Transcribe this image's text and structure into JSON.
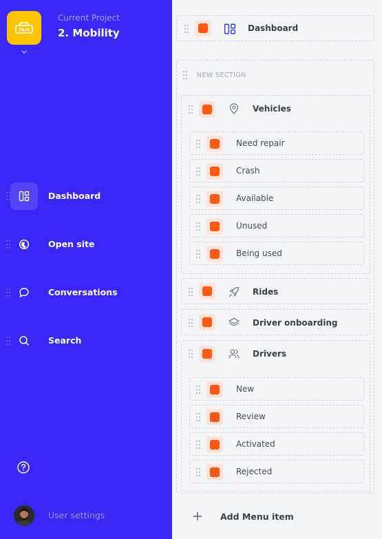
{
  "project": {
    "label": "Current Project",
    "name": "2. Mobility",
    "logo_text": "TAXI"
  },
  "sidebar": {
    "items": [
      {
        "label": "Dashboard",
        "icon": "dashboard-icon",
        "active": true
      },
      {
        "label": "Open site",
        "icon": "globe-icon",
        "active": false
      },
      {
        "label": "Conversations",
        "icon": "chat-icon",
        "active": false
      },
      {
        "label": "Search",
        "icon": "search-icon",
        "active": false
      }
    ],
    "user_settings": "User settings"
  },
  "menu": {
    "dashboard": {
      "label": "Dashboard",
      "icon": "dashboard-icon"
    },
    "section_title": "NEW SECTION",
    "vehicles": {
      "label": "Vehicles",
      "icon": "location-pin-icon",
      "children": [
        "Need repair",
        "Crash",
        "Available",
        "Unused",
        "Being used"
      ]
    },
    "rides": {
      "label": "Rides",
      "icon": "rocket-icon"
    },
    "driver_onboarding": {
      "label": "Driver onboarding",
      "icon": "layers-icon"
    },
    "drivers": {
      "label": "Drivers",
      "icon": "users-icon",
      "children": [
        "New",
        "Review",
        "Activated",
        "Rejected"
      ]
    },
    "add_label": "Add Menu item"
  },
  "colors": {
    "sidebar": "#3a26f5",
    "accent_orange": "#fb5a14",
    "logo_yellow": "#ffc400"
  }
}
